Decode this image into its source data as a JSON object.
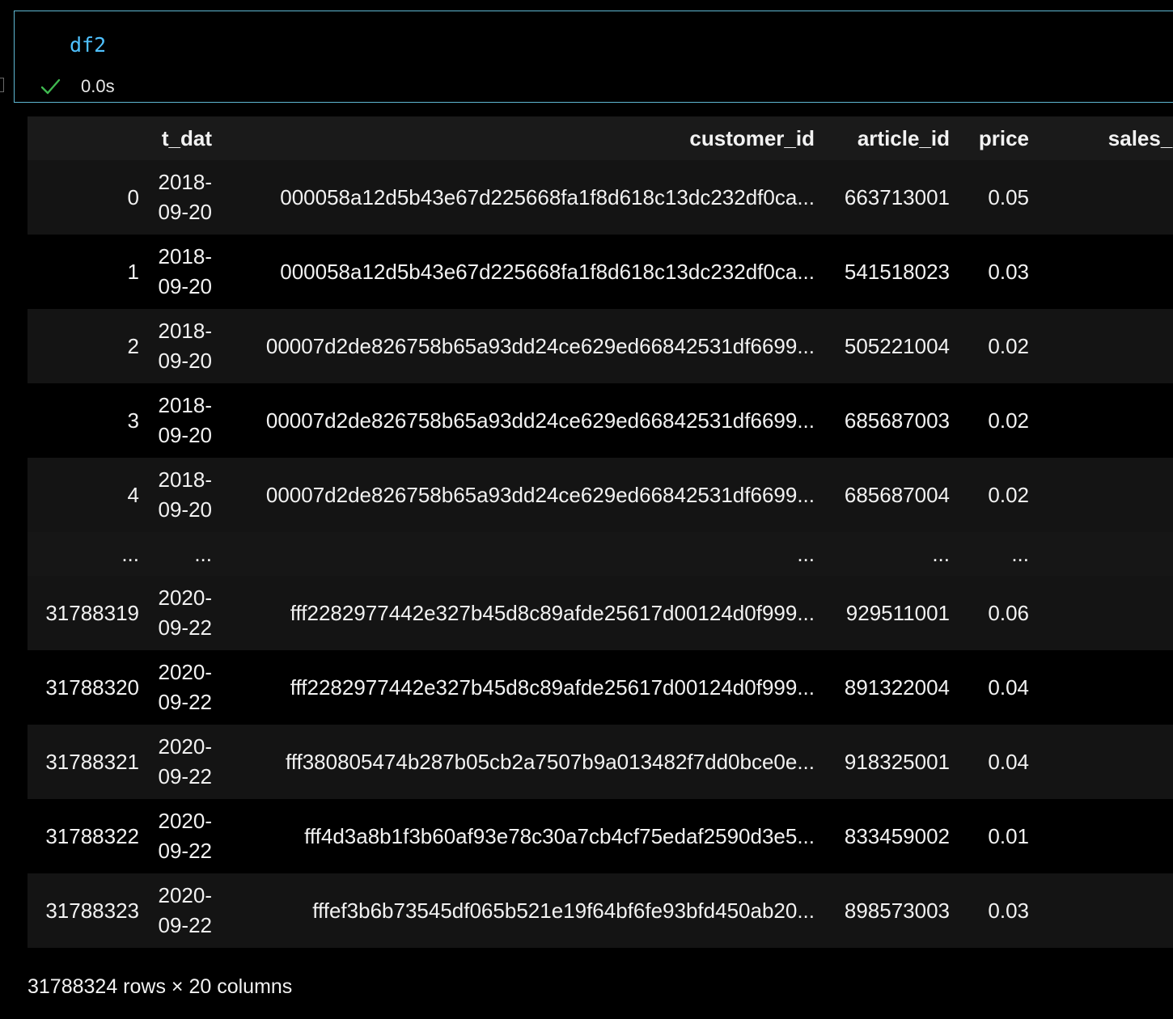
{
  "cell": {
    "code": "df2",
    "status_icon": "checkmark-icon",
    "exec_time": "0.0s"
  },
  "table": {
    "columns": [
      "",
      "t_dat",
      "customer_id",
      "article_id",
      "price",
      "sales_chan"
    ],
    "rows": [
      {
        "index": "0",
        "t_dat_1": "2018-",
        "t_dat_2": "09-20",
        "customer_id": "000058a12d5b43e67d225668fa1f8d618c13dc232df0ca...",
        "article_id": "663713001",
        "price": "0.05"
      },
      {
        "index": "1",
        "t_dat_1": "2018-",
        "t_dat_2": "09-20",
        "customer_id": "000058a12d5b43e67d225668fa1f8d618c13dc232df0ca...",
        "article_id": "541518023",
        "price": "0.03"
      },
      {
        "index": "2",
        "t_dat_1": "2018-",
        "t_dat_2": "09-20",
        "customer_id": "00007d2de826758b65a93dd24ce629ed66842531df6699...",
        "article_id": "505221004",
        "price": "0.02"
      },
      {
        "index": "3",
        "t_dat_1": "2018-",
        "t_dat_2": "09-20",
        "customer_id": "00007d2de826758b65a93dd24ce629ed66842531df6699...",
        "article_id": "685687003",
        "price": "0.02"
      },
      {
        "index": "4",
        "t_dat_1": "2018-",
        "t_dat_2": "09-20",
        "customer_id": "00007d2de826758b65a93dd24ce629ed66842531df6699...",
        "article_id": "685687004",
        "price": "0.02"
      }
    ],
    "ellipsis": {
      "index": "...",
      "t_dat": "...",
      "customer_id": "...",
      "article_id": "...",
      "price": "..."
    },
    "tail_rows": [
      {
        "index": "31788319",
        "t_dat_1": "2020-",
        "t_dat_2": "09-22",
        "customer_id": "fff2282977442e327b45d8c89afde25617d00124d0f999...",
        "article_id": "929511001",
        "price": "0.06"
      },
      {
        "index": "31788320",
        "t_dat_1": "2020-",
        "t_dat_2": "09-22",
        "customer_id": "fff2282977442e327b45d8c89afde25617d00124d0f999...",
        "article_id": "891322004",
        "price": "0.04"
      },
      {
        "index": "31788321",
        "t_dat_1": "2020-",
        "t_dat_2": "09-22",
        "customer_id": "fff380805474b287b05cb2a7507b9a013482f7dd0bce0e...",
        "article_id": "918325001",
        "price": "0.04"
      },
      {
        "index": "31788322",
        "t_dat_1": "2020-",
        "t_dat_2": "09-22",
        "customer_id": "fff4d3a8b1f3b60af93e78c30a7cb4cf75edaf2590d3e5...",
        "article_id": "833459002",
        "price": "0.01"
      },
      {
        "index": "31788323",
        "t_dat_1": "2020-",
        "t_dat_2": "09-22",
        "customer_id": "fffef3b6b73545df065b521e19f64bf6fe93bfd450ab20...",
        "article_id": "898573003",
        "price": "0.03"
      }
    ]
  },
  "footer": {
    "summary": "31788324 rows × 20 columns"
  },
  "colors": {
    "cell_border": "#5fb8d3",
    "code_text": "#4fc1ff",
    "success_check": "#3fb950",
    "row_alt": "#141414",
    "header_bg": "#1a1a1a"
  }
}
